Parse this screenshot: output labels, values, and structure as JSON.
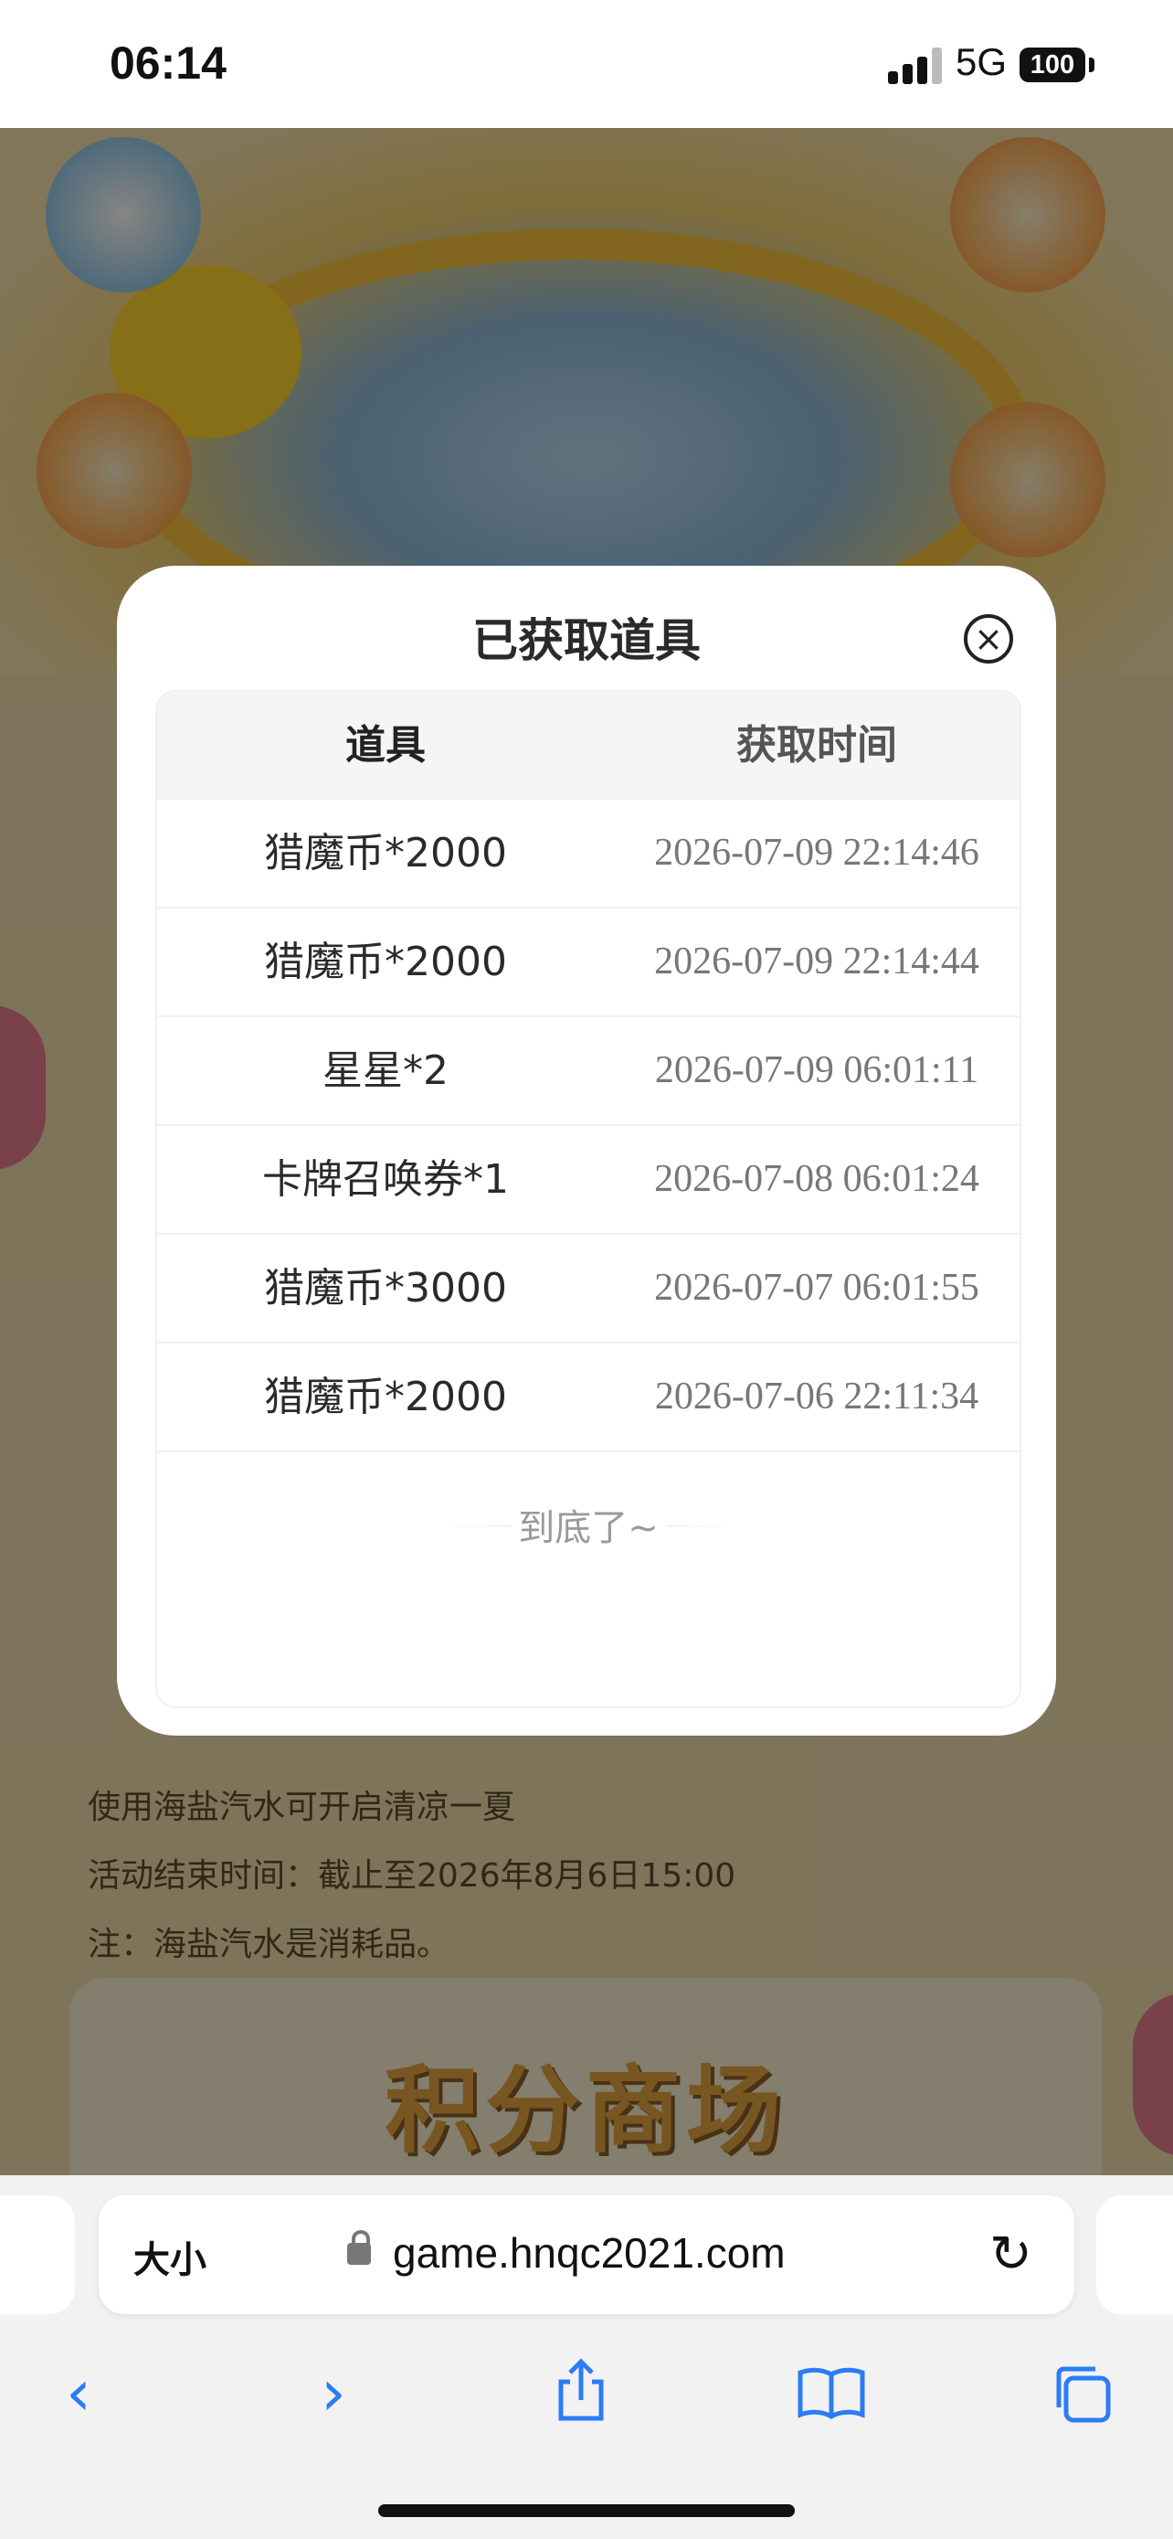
{
  "status_bar": {
    "time": "06:14",
    "network": "5G",
    "battery": "100"
  },
  "background": {
    "notes": [
      "使用海盐汽水可开启清凉一夏",
      "活动结束时间：截止至2026年8月6日15:00",
      "注：海盐汽水是消耗品。"
    ],
    "shop_title": "积分商场"
  },
  "modal": {
    "title": "已获取道具",
    "close_icon": "close-circle-icon",
    "columns": [
      "道具",
      "获取时间"
    ],
    "rows": [
      {
        "item": "猎魔币*2000",
        "time": "2026-07-09 22:14:46"
      },
      {
        "item": "猎魔币*2000",
        "time": "2026-07-09 22:14:44"
      },
      {
        "item": "星星*2",
        "time": "2026-07-09 06:01:11"
      },
      {
        "item": "卡牌召唤券*1",
        "time": "2026-07-08 06:01:24"
      },
      {
        "item": "猎魔币*3000",
        "time": "2026-07-07 06:01:55"
      },
      {
        "item": "猎魔币*2000",
        "time": "2026-07-06 22:11:34"
      }
    ],
    "end_text": "到底了~"
  },
  "browser": {
    "text_size_label": "大小",
    "url": "game.hnqc2021.com",
    "toolbar": [
      "back-icon",
      "forward-icon",
      "share-icon",
      "bookmarks-icon",
      "tabs-icon"
    ]
  }
}
